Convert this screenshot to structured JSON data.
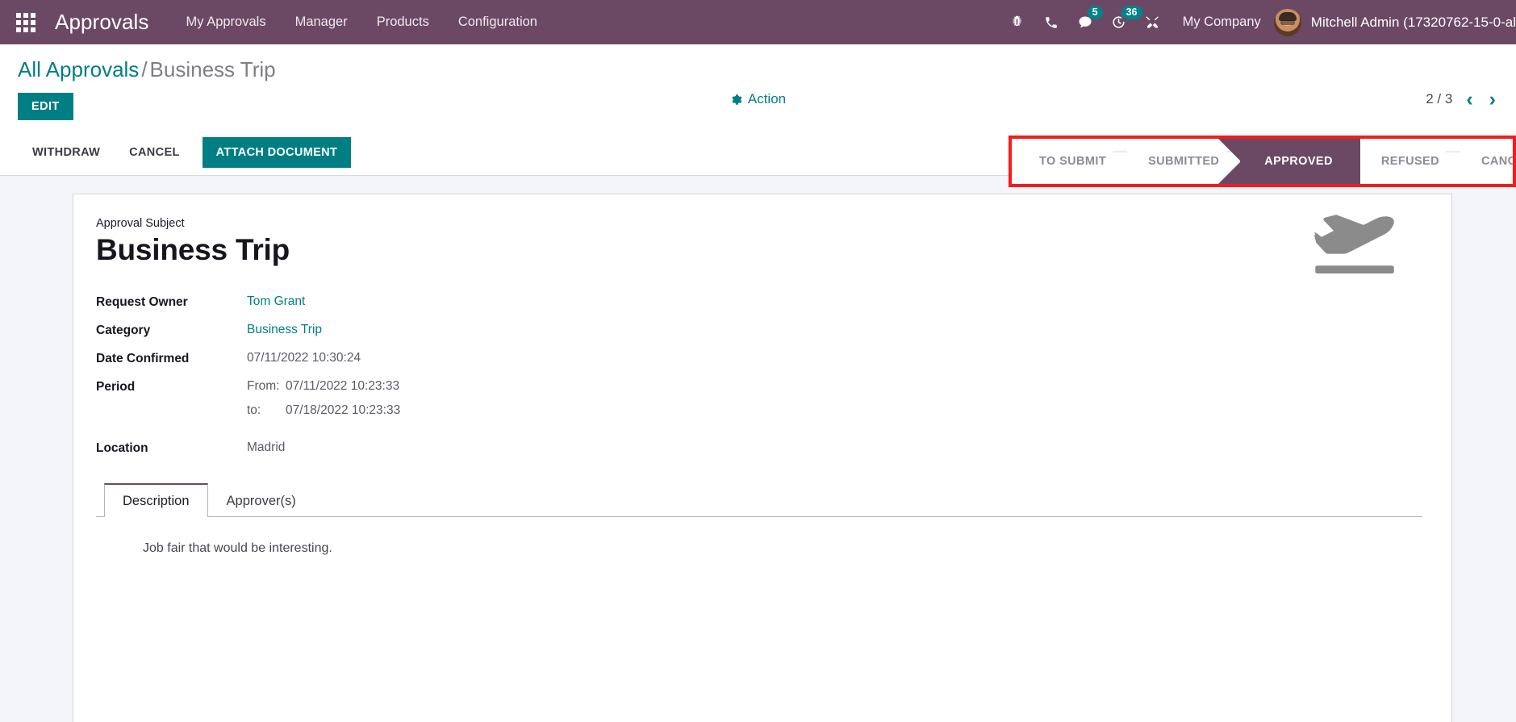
{
  "navbar": {
    "apps_icon": "apps-grid-icon",
    "brand": "Approvals",
    "menu": [
      {
        "label": "My Approvals"
      },
      {
        "label": "Manager"
      },
      {
        "label": "Products"
      },
      {
        "label": "Configuration"
      }
    ],
    "icons": [
      {
        "name": "bug-icon",
        "badge": null
      },
      {
        "name": "phone-icon",
        "badge": null
      },
      {
        "name": "messages-icon",
        "badge": "5"
      },
      {
        "name": "activities-clock-icon",
        "badge": "36"
      },
      {
        "name": "tools-icon",
        "badge": null
      }
    ],
    "company": "My Company",
    "user": "Mitchell Admin (17320762-15-0-al",
    "background_color": "#6B4965",
    "badge_color": "#00848B"
  },
  "control_panel": {
    "breadcrumb": {
      "root": "All Approvals",
      "separator": "/",
      "current": "Business Trip"
    },
    "edit_label": "EDIT",
    "action_label": "Action",
    "pager": {
      "value": "2 / 3",
      "prev_glyph": "‹",
      "next_glyph": "›"
    },
    "buttons": [
      {
        "label": "WITHDRAW",
        "style": "secondary"
      },
      {
        "label": "CANCEL",
        "style": "secondary"
      },
      {
        "label": "ATTACH DOCUMENT",
        "style": "primary"
      }
    ],
    "statusbar": {
      "highlight_color": "#F51B1B",
      "active_color": "#6B4965",
      "stages": [
        {
          "label": "TO SUBMIT",
          "active": false
        },
        {
          "label": "SUBMITTED",
          "active": false
        },
        {
          "label": "APPROVED",
          "active": true
        },
        {
          "label": "REFUSED",
          "active": false
        },
        {
          "label": "CANCEL",
          "active": false
        }
      ]
    }
  },
  "form": {
    "subject_label": "Approval Subject",
    "subject_value": "Business Trip",
    "category_icon": "plane-departure-icon",
    "fields": [
      {
        "label": "Request Owner",
        "value": "Tom Grant",
        "link": true
      },
      {
        "label": "Category",
        "value": "Business Trip",
        "link": true
      },
      {
        "label": "Date Confirmed",
        "value": "07/11/2022 10:30:24",
        "link": false
      }
    ],
    "period": {
      "label": "Period",
      "from_key": "From:",
      "from_value": "07/11/2022 10:23:33",
      "to_key": "to:",
      "to_value": "07/18/2022 10:23:33"
    },
    "location": {
      "label": "Location",
      "value": "Madrid"
    },
    "notebook": {
      "tabs": [
        {
          "label": "Description",
          "active": true
        },
        {
          "label": "Approver(s)",
          "active": false
        }
      ],
      "description_text": "Job fair that would be interesting."
    }
  },
  "accent_colors": {
    "teal": "#017E84",
    "purple": "#6B4965",
    "red_highlight": "#F51B1B"
  }
}
